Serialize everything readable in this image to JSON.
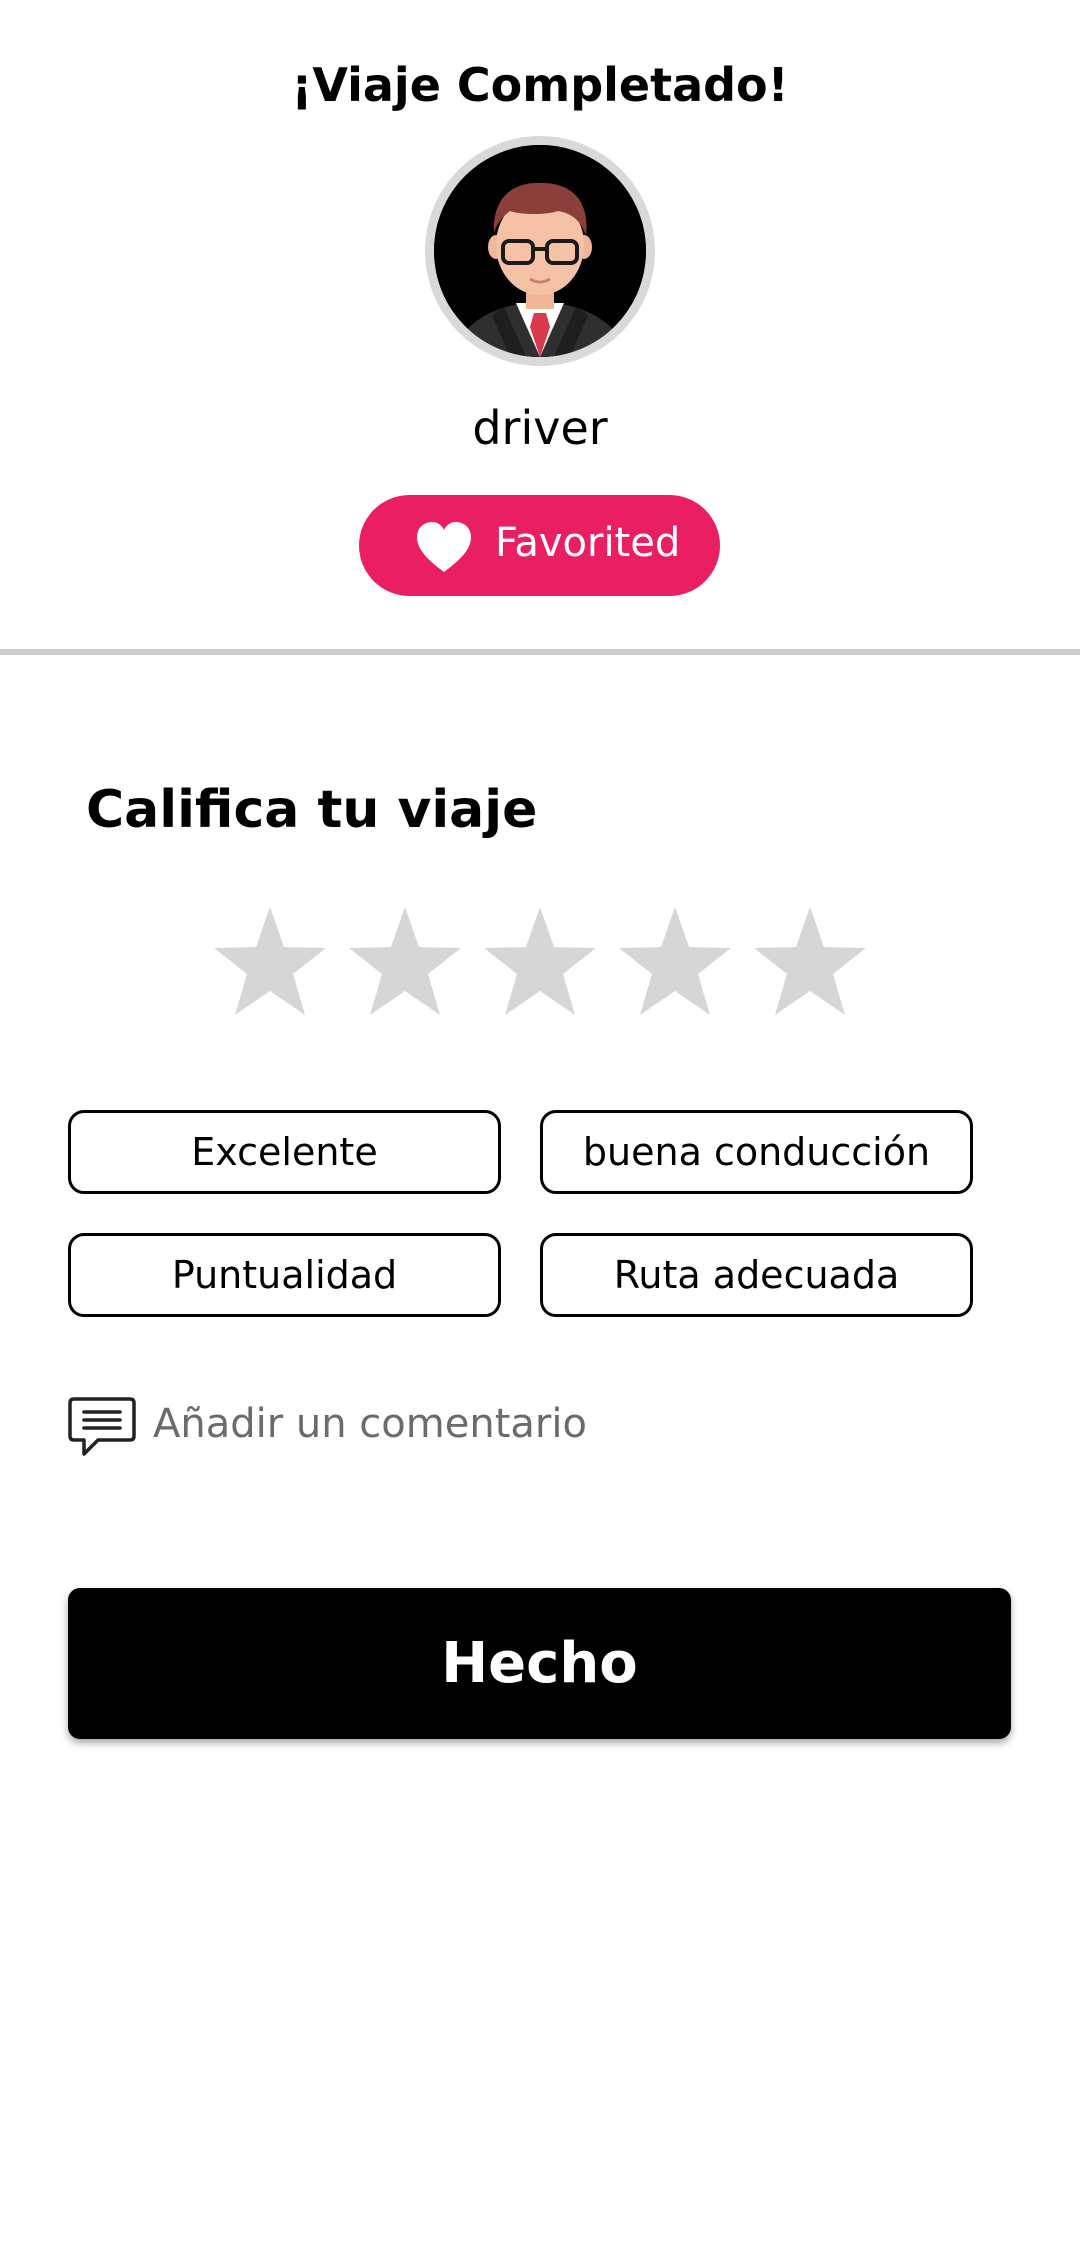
{
  "header": {
    "title": "¡Viaje Completado!",
    "driver": {
      "avatar_icon": "driver-avatar",
      "name": "driver"
    },
    "favorite": {
      "icon": "heart-icon",
      "label": "Favorited",
      "state": "favorited"
    }
  },
  "rating": {
    "title": "Califica tu viaje",
    "stars_total": 5,
    "stars_selected": 0,
    "star_icon": "star-icon"
  },
  "tags": [
    {
      "label": "Excelente"
    },
    {
      "label": "buena conducción"
    },
    {
      "label": "Puntualidad"
    },
    {
      "label": "Ruta adecuada"
    }
  ],
  "comment": {
    "icon": "comment-icon",
    "placeholder": "Añadir un comentario"
  },
  "done_button": {
    "label": "Hecho"
  },
  "colors": {
    "accent": "#e91e63",
    "star_inactive": "#d6d6d6",
    "primary_button": "#000000",
    "divider": "#cccccc",
    "placeholder_text": "#6b6b6b"
  }
}
